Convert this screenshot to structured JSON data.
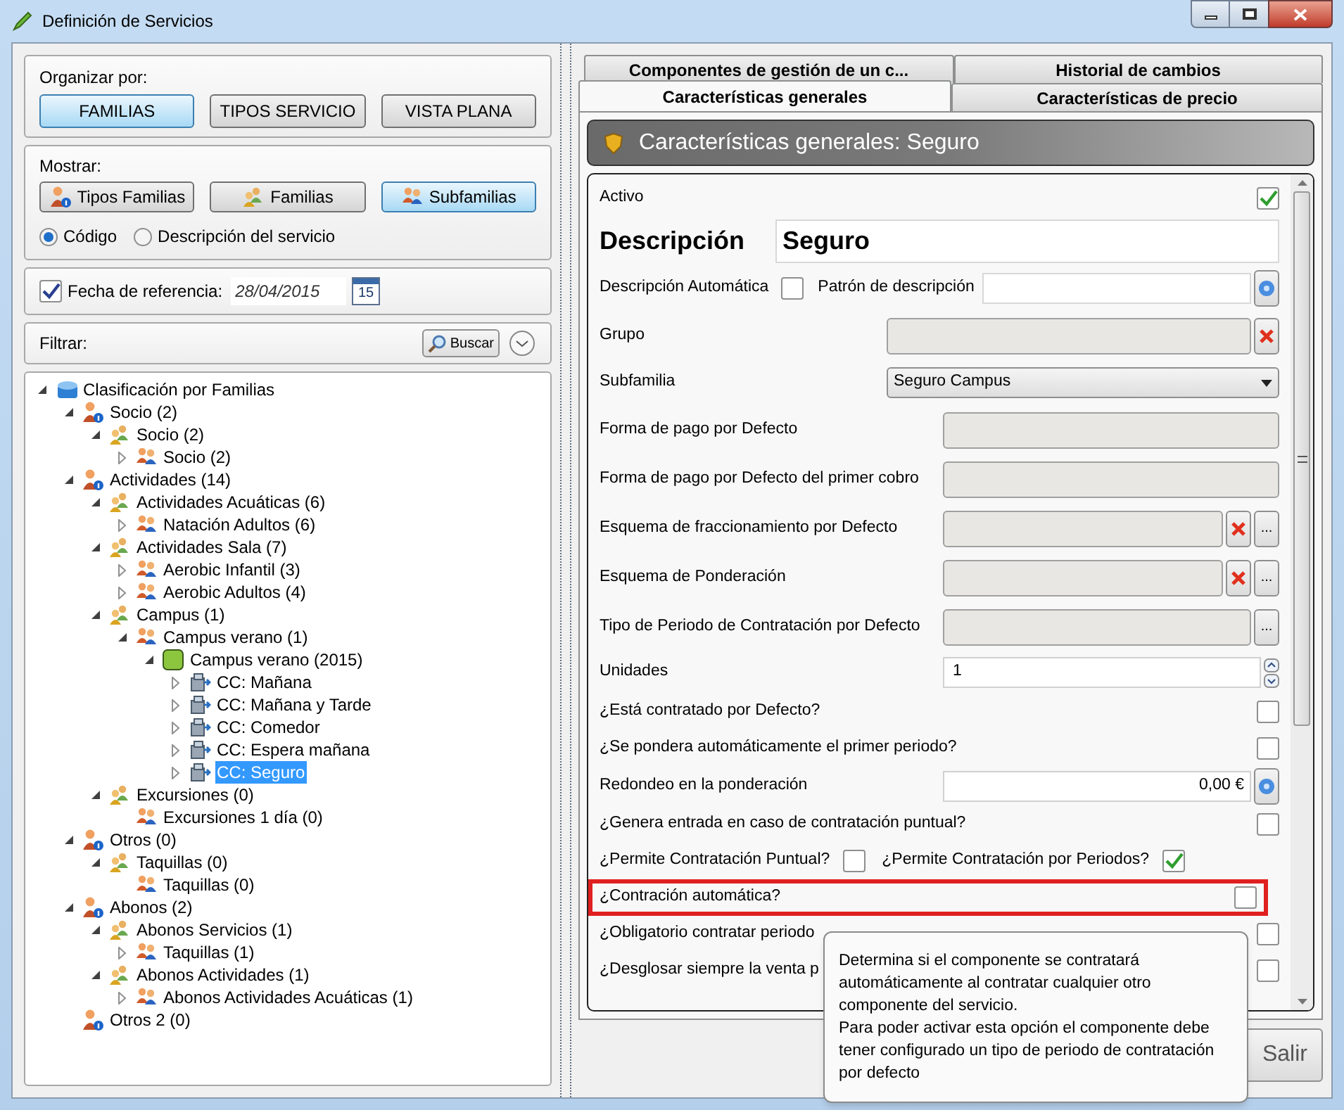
{
  "window": {
    "title": "Definición de Servicios"
  },
  "organize": {
    "label": "Organizar por:",
    "options": [
      {
        "label": "FAMILIAS",
        "selected": true
      },
      {
        "label": "TIPOS SERVICIO",
        "selected": false
      },
      {
        "label": "VISTA PLANA",
        "selected": false
      }
    ]
  },
  "show": {
    "label": "Mostrar:",
    "options": [
      {
        "label": "Tipos Familias",
        "kind": "type",
        "selected": false
      },
      {
        "label": "Familias",
        "kind": "family",
        "selected": false
      },
      {
        "label": "Subfamilias",
        "kind": "subfamily",
        "selected": true
      }
    ],
    "radios": [
      {
        "label": "Código",
        "selected": true
      },
      {
        "label": "Descripción del servicio",
        "selected": false
      }
    ]
  },
  "date": {
    "label": "Fecha de referencia:",
    "checked": true,
    "value": "28/04/2015",
    "calendar_day": "15"
  },
  "filter": {
    "label": "Filtrar:",
    "button": "Buscar"
  },
  "tree": [
    {
      "label": "Clasificación por Familias",
      "kind": "root",
      "expanded": true,
      "selected": false,
      "children": [
        {
          "label": "Socio (2)",
          "kind": "type",
          "expanded": true,
          "selected": false,
          "children": [
            {
              "label": "Socio (2)",
              "kind": "family",
              "expanded": true,
              "selected": false,
              "children": [
                {
                  "label": "Socio (2)",
                  "kind": "subfamily",
                  "expanded": false,
                  "selected": false
                }
              ]
            }
          ]
        },
        {
          "label": "Actividades (14)",
          "kind": "type",
          "expanded": true,
          "selected": false,
          "children": [
            {
              "label": "Actividades Acuáticas (6)",
              "kind": "family",
              "expanded": true,
              "selected": false,
              "children": [
                {
                  "label": "Natación Adultos (6)",
                  "kind": "subfamily",
                  "expanded": false,
                  "selected": false
                }
              ]
            },
            {
              "label": "Actividades Sala (7)",
              "kind": "family",
              "expanded": true,
              "selected": false,
              "children": [
                {
                  "label": "Aerobic Infantil (3)",
                  "kind": "subfamily",
                  "expanded": false,
                  "selected": false
                },
                {
                  "label": "Aerobic Adultos (4)",
                  "kind": "subfamily",
                  "expanded": false,
                  "selected": false
                }
              ]
            },
            {
              "label": "Campus (1)",
              "kind": "family",
              "expanded": true,
              "selected": false,
              "children": [
                {
                  "label": "Campus verano (1)",
                  "kind": "subfamily",
                  "expanded": true,
                  "selected": false,
                  "children": [
                    {
                      "label": "Campus verano (2015)",
                      "kind": "campaign",
                      "expanded": true,
                      "selected": false,
                      "children": [
                        {
                          "label": "CC: Mañana",
                          "kind": "component",
                          "expanded": false,
                          "selected": false
                        },
                        {
                          "label": "CC: Mañana y Tarde",
                          "kind": "component",
                          "expanded": false,
                          "selected": false
                        },
                        {
                          "label": "CC: Comedor",
                          "kind": "component",
                          "expanded": false,
                          "selected": false
                        },
                        {
                          "label": "CC: Espera mañana",
                          "kind": "component",
                          "expanded": false,
                          "selected": false
                        },
                        {
                          "label": "CC: Seguro",
                          "kind": "component",
                          "expanded": false,
                          "selected": true
                        }
                      ]
                    }
                  ]
                }
              ]
            },
            {
              "label": "Excursiones (0)",
              "kind": "family",
              "expanded": true,
              "selected": false,
              "children": [
                {
                  "label": "Excursiones 1 día (0)",
                  "kind": "subfamily",
                  "selected": false
                }
              ]
            }
          ]
        },
        {
          "label": "Otros (0)",
          "kind": "type",
          "expanded": true,
          "selected": false,
          "children": [
            {
              "label": "Taquillas (0)",
              "kind": "family",
              "expanded": true,
              "selected": false,
              "children": [
                {
                  "label": "Taquillas (0)",
                  "kind": "subfamily",
                  "selected": false
                }
              ]
            }
          ]
        },
        {
          "label": "Abonos (2)",
          "kind": "type",
          "expanded": true,
          "selected": false,
          "children": [
            {
              "label": "Abonos Servicios (1)",
              "kind": "family",
              "expanded": true,
              "selected": false,
              "children": [
                {
                  "label": "Taquillas (1)",
                  "kind": "subfamily",
                  "expanded": false,
                  "selected": false
                }
              ]
            },
            {
              "label": "Abonos Actividades (1)",
              "kind": "family",
              "expanded": true,
              "selected": false,
              "children": [
                {
                  "label": "Abonos Actividades Acuáticas (1)",
                  "kind": "subfamily",
                  "expanded": false,
                  "selected": false
                }
              ]
            }
          ]
        },
        {
          "label": "Otros 2 (0)",
          "kind": "type",
          "selected": false
        }
      ]
    }
  ],
  "tab_rows": [
    {
      "tabs": [
        {
          "label": "Componentes de gestión de un c...",
          "selected": false
        },
        {
          "label": "Historial de cambios",
          "selected": false
        }
      ]
    },
    {
      "tabs": [
        {
          "label": "Características generales",
          "selected": true
        },
        {
          "label": "Características de precio",
          "selected": false
        }
      ]
    }
  ],
  "header": "Características generales: Seguro",
  "form": [
    {
      "kind": "checkbox",
      "label": "Activo",
      "checked": true,
      "highlighted": false
    },
    {
      "kind": "title",
      "label": "Descripción",
      "value": "Seguro",
      "highlighted": false
    },
    {
      "kind": "pattern",
      "label": "Descripción Automática",
      "checked": false,
      "label_2": "Patrón de descripción",
      "highlighted": false
    },
    {
      "kind": "lookup",
      "label": "Grupo",
      "wide": true,
      "buttons": [
        {
          "kind": "clear"
        }
      ],
      "highlighted": false
    },
    {
      "kind": "select",
      "label": "Subfamilia",
      "value": "Seguro Campus",
      "highlighted": false
    },
    {
      "kind": "lookup",
      "label": "Forma de pago por Defecto",
      "wide": false,
      "highlighted": false
    },
    {
      "kind": "lookup",
      "label": "Forma de pago por Defecto del primer cobro",
      "wide": false,
      "highlighted": false
    },
    {
      "kind": "lookup",
      "label": "Esquema de fraccionamiento por Defecto",
      "wide": false,
      "buttons": [
        {
          "kind": "clear"
        },
        {
          "kind": "browse",
          "label": "..."
        }
      ],
      "highlighted": false
    },
    {
      "kind": "lookup",
      "label": "Esquema de Ponderación",
      "wide": false,
      "buttons": [
        {
          "kind": "clear"
        },
        {
          "kind": "browse",
          "label": "..."
        }
      ],
      "highlighted": false
    },
    {
      "kind": "lookup",
      "label": "Tipo de Periodo de Contratación por Defecto",
      "wide": false,
      "buttons": [
        {
          "kind": "browse",
          "label": "..."
        }
      ],
      "highlighted": false
    },
    {
      "kind": "spin",
      "label": "Unidades",
      "value": "1",
      "highlighted": false
    },
    {
      "kind": "checkbox",
      "label": "¿Está contratado por Defecto?",
      "checked": false,
      "highlighted": false
    },
    {
      "kind": "checkbox",
      "label": "¿Se pondera automáticamente el primer periodo?",
      "checked": false,
      "highlighted": false
    },
    {
      "kind": "money",
      "label": "Redondeo en la ponderación",
      "value": "0,00 €",
      "highlighted": false
    },
    {
      "kind": "checkbox",
      "label": "¿Genera entrada en caso de contratación puntual?",
      "checked": false,
      "highlighted": false
    },
    {
      "kind": "double",
      "label": "¿Permite Contratación Puntual?",
      "checked": false,
      "label_2": "¿Permite Contratación por Periodos?",
      "checked_2": true,
      "highlighted": false
    },
    {
      "kind": "checkbox",
      "label": "¿Contración automática?",
      "checked": false,
      "highlighted": true
    },
    {
      "kind": "checkbox",
      "label": "¿Obligatorio contratar periodo",
      "checked": false,
      "highlighted": false
    },
    {
      "kind": "checkbox",
      "label": "¿Desglosar siempre la venta p",
      "checked": false,
      "highlighted": false
    }
  ],
  "tooltip": [
    "Determina si el componente se contratará automáticamente al contratar cualquier otro componente del servicio.",
    "Para poder activar esta opción el componente debe tener configurado un tipo de periodo de contratación por defecto"
  ],
  "exit_button": "Salir"
}
